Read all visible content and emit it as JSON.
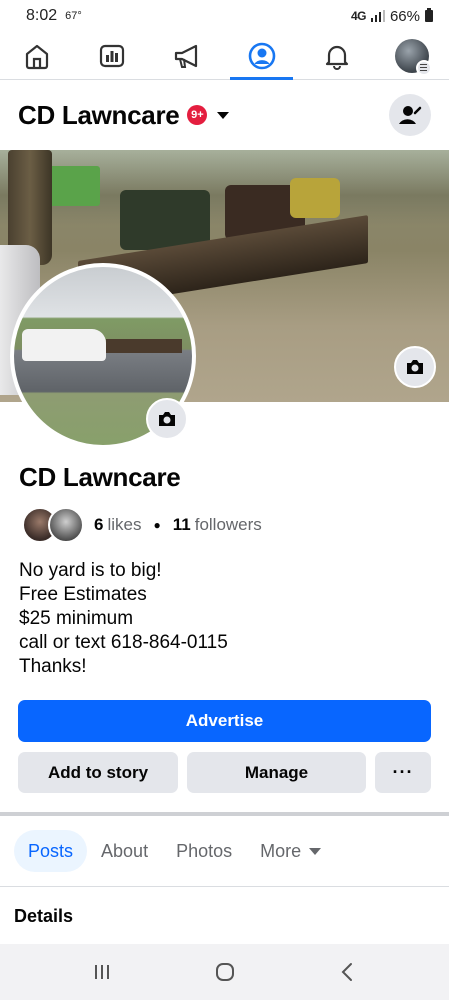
{
  "status_bar": {
    "time": "8:02",
    "temp": "67°",
    "network": "4G",
    "battery": "66%"
  },
  "top_nav": {
    "items": [
      {
        "icon": "home-icon"
      },
      {
        "icon": "insights-icon"
      },
      {
        "icon": "megaphone-icon"
      },
      {
        "icon": "profile-icon",
        "active": true
      },
      {
        "icon": "bell-icon"
      },
      {
        "icon": "menu-avatar-icon"
      }
    ],
    "accent": "#1877f2"
  },
  "header": {
    "title": "CD Lawncare",
    "badge": "9+",
    "badge_color": "#e41e3f"
  },
  "profile": {
    "name": "CD Lawncare",
    "likes_count": "6",
    "likes_label": "likes",
    "followers_count": "11",
    "followers_label": "followers",
    "bio": [
      "No yard is to big!",
      "Free Estimates",
      "$25 minimum",
      "call or text 618-864-0115",
      "Thanks!"
    ]
  },
  "buttons": {
    "advertise": "Advertise",
    "add_to_story": "Add to story",
    "manage": "Manage",
    "more": "···",
    "primary_color": "#0866ff"
  },
  "tabs": [
    {
      "label": "Posts",
      "active": true
    },
    {
      "label": "About"
    },
    {
      "label": "Photos"
    },
    {
      "label": "More"
    }
  ],
  "section": {
    "details_title": "Details"
  }
}
